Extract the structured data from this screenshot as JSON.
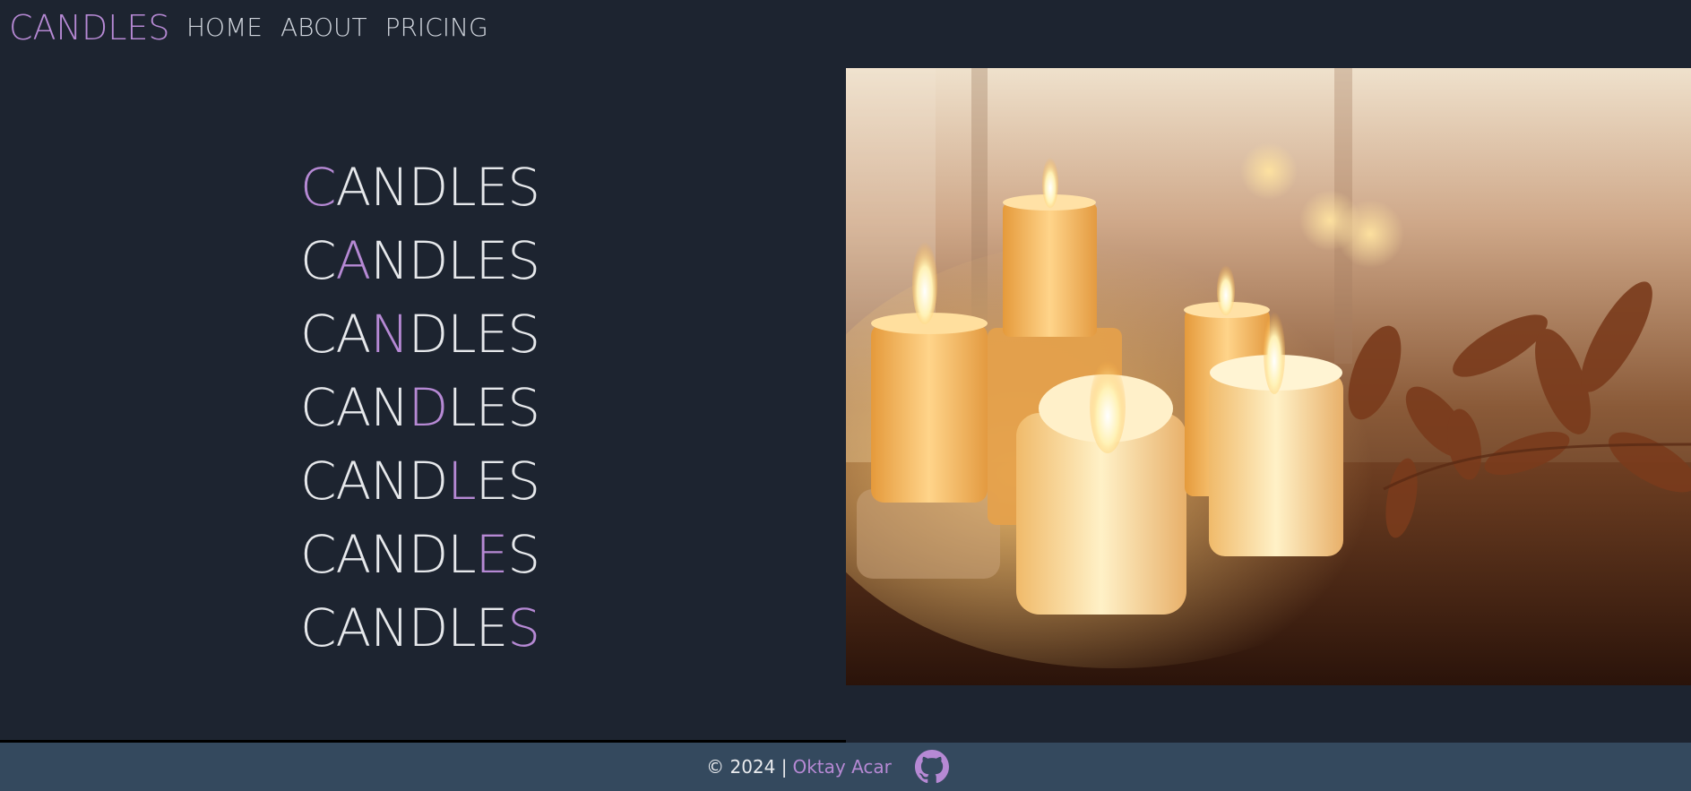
{
  "nav": {
    "brand": "CANDLES",
    "links": [
      "HOME",
      "ABOUT",
      "PRICING"
    ]
  },
  "hero": {
    "word": "CANDLES",
    "rows": [
      {
        "highlight_index": 0
      },
      {
        "highlight_index": 1
      },
      {
        "highlight_index": 2
      },
      {
        "highlight_index": 3
      },
      {
        "highlight_index": 4
      },
      {
        "highlight_index": 5
      },
      {
        "highlight_index": 6
      }
    ]
  },
  "photo": {
    "subject": "lit candles on wooden table"
  },
  "footer": {
    "copyright": "© 2024 |",
    "author": "Oktay Acar",
    "icon": "github-icon"
  },
  "colors": {
    "background": "#1d2430",
    "accent": "#b689d4",
    "footer_bg": "#34495e"
  }
}
